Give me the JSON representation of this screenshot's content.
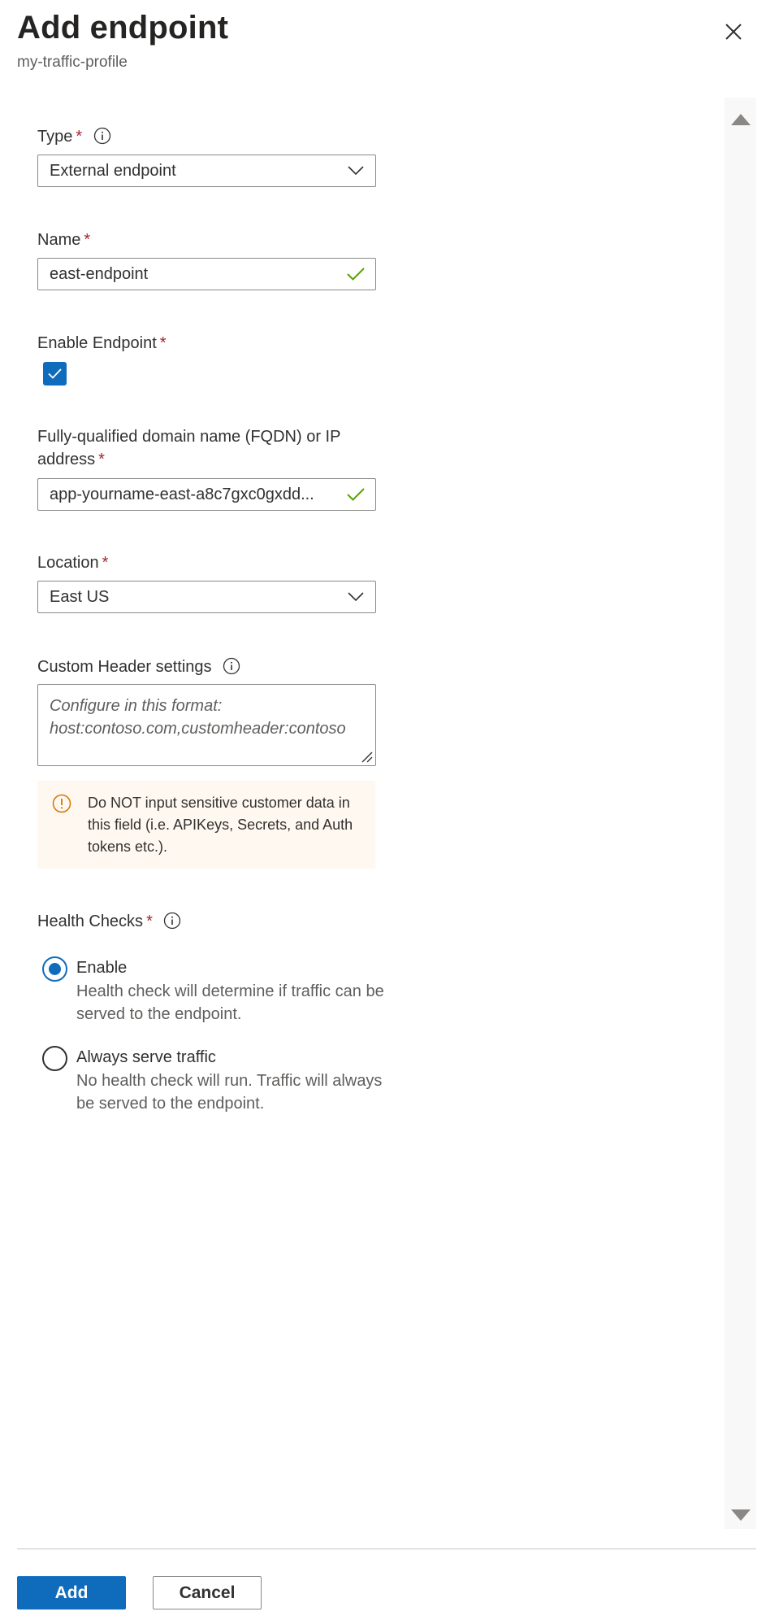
{
  "header": {
    "title": "Add endpoint",
    "subtitle": "my-traffic-profile"
  },
  "form": {
    "type": {
      "label": "Type",
      "required": "*",
      "value": "External endpoint"
    },
    "name": {
      "label": "Name",
      "required": "*",
      "value": "east-endpoint"
    },
    "enable_endpoint": {
      "label": "Enable Endpoint",
      "required": "*",
      "checked": true
    },
    "fqdn": {
      "label": "Fully-qualified domain name (FQDN) or IP address",
      "required": "*",
      "value": "app-yourname-east-a8c7gxc0gxdd..."
    },
    "location": {
      "label": "Location",
      "required": "*",
      "value": "East US"
    },
    "custom_header": {
      "label": "Custom Header settings",
      "placeholder_line1": "Configure in this format:",
      "placeholder_line2": "host:contoso.com,customheader:contoso"
    },
    "warning": "Do NOT input sensitive customer data in this field (i.e. APIKeys, Secrets, and Auth tokens etc.).",
    "health_checks": {
      "label": "Health Checks",
      "required": "*",
      "options": [
        {
          "title": "Enable",
          "description": "Health check will determine if traffic can be served to the endpoint.",
          "selected": true
        },
        {
          "title": "Always serve traffic",
          "description": "No health check will run. Traffic will always be served to the endpoint.",
          "selected": false
        }
      ]
    }
  },
  "footer": {
    "add_label": "Add",
    "cancel_label": "Cancel"
  },
  "colors": {
    "accent": "#0f6cbd",
    "success": "#57a300",
    "required": "#a4262c",
    "warning_bg": "#fff8f0",
    "warning_icon": "#d47500"
  }
}
